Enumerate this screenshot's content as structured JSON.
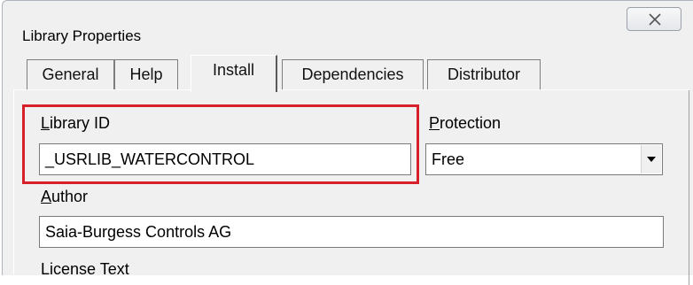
{
  "window": {
    "title": "Library Properties",
    "close_icon": "close-x-icon"
  },
  "tabs": [
    {
      "label": "General",
      "active": false
    },
    {
      "label": "Help",
      "active": false
    },
    {
      "label": "Install",
      "active": true
    },
    {
      "label": "Dependencies",
      "active": false
    },
    {
      "label": "Distributor",
      "active": false
    }
  ],
  "form": {
    "library_id": {
      "label_prefix": "",
      "label_hotkey": "L",
      "label_rest": "ibrary ID",
      "value": "_USRLIB_WATERCONTROL"
    },
    "protection": {
      "label_hotkey": "P",
      "label_rest": "rotection",
      "value": "Free"
    },
    "author": {
      "label_hotkey": "A",
      "label_rest": "uthor",
      "value": "Saia-Burgess Controls AG"
    },
    "license_text": {
      "label": "License Text"
    }
  },
  "colors": {
    "highlight": "#d8202a",
    "dialog_bg": "#f0f0f0"
  }
}
